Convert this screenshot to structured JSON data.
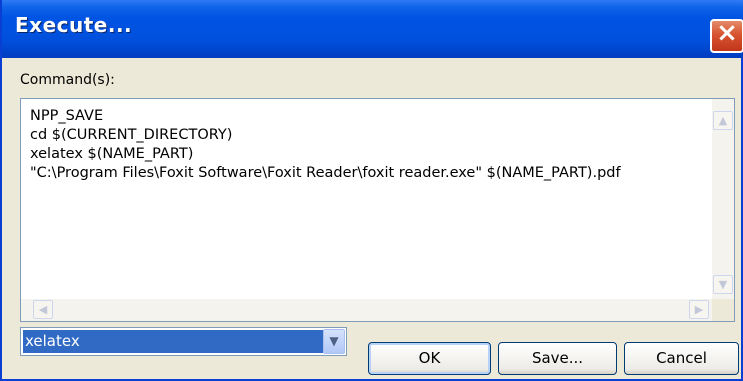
{
  "window": {
    "title": "Execute..."
  },
  "editor": {
    "label": "Command(s):",
    "lines": [
      "NPP_SAVE",
      "cd $(CURRENT_DIRECTORY)",
      "xelatex $(NAME_PART)",
      "\"C:\\Program Files\\Foxit Software\\Foxit Reader\\foxit reader.exe\" $(NAME_PART).pdf"
    ]
  },
  "script_select": {
    "value": "xelatex"
  },
  "buttons": {
    "ok": "OK",
    "save": "Save...",
    "cancel": "Cancel"
  },
  "icons": {
    "close": "×",
    "up": "▲",
    "down": "▼",
    "left": "◀",
    "right": "▶",
    "dropdown": "▼"
  }
}
